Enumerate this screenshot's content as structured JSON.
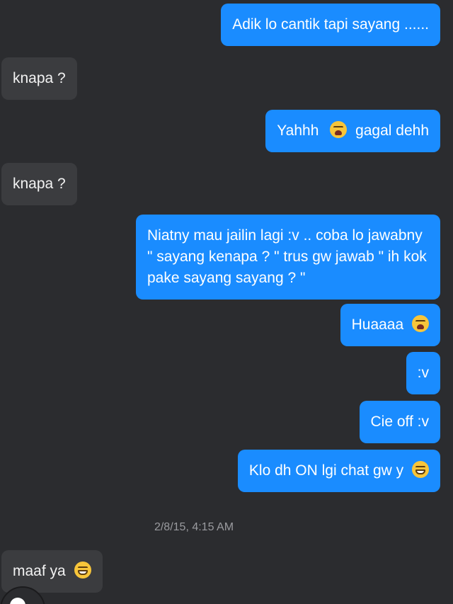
{
  "messages": [
    {
      "direction": "out",
      "text": "Adik lo cantik tapi sayang ......"
    },
    {
      "direction": "in",
      "text": "knapa ?"
    },
    {
      "direction": "out",
      "text_before": "Yahhh",
      "emoji": "crying-face-emoji",
      "text_after": "gagal dehh"
    },
    {
      "direction": "in",
      "text": "knapa ?"
    },
    {
      "direction": "out",
      "text": "Niatny mau jailin lagi :v .. coba lo jawabny \" sayang kenapa ? \" trus gw jawab \" ih kok pake sayang sayang ? \""
    },
    {
      "direction": "out",
      "text": "Huaaaa",
      "emoji": "crying-face-emoji"
    },
    {
      "direction": "out",
      "text": ":v"
    },
    {
      "direction": "out",
      "text": "Cie off :v"
    },
    {
      "direction": "out",
      "text": "Klo dh ON lgi chat gw y",
      "emoji": "grinning-face-emoji"
    },
    {
      "direction": "in",
      "text": "maaf ya",
      "emoji": "grinning-face-emoji"
    }
  ],
  "timestamp": "2/8/15, 4:15 AM",
  "colors": {
    "background": "#2b2c2f",
    "outgoing_bubble": "#1a8cff",
    "incoming_bubble": "#3b3c3f",
    "timestamp_text": "#9a9b9f"
  }
}
